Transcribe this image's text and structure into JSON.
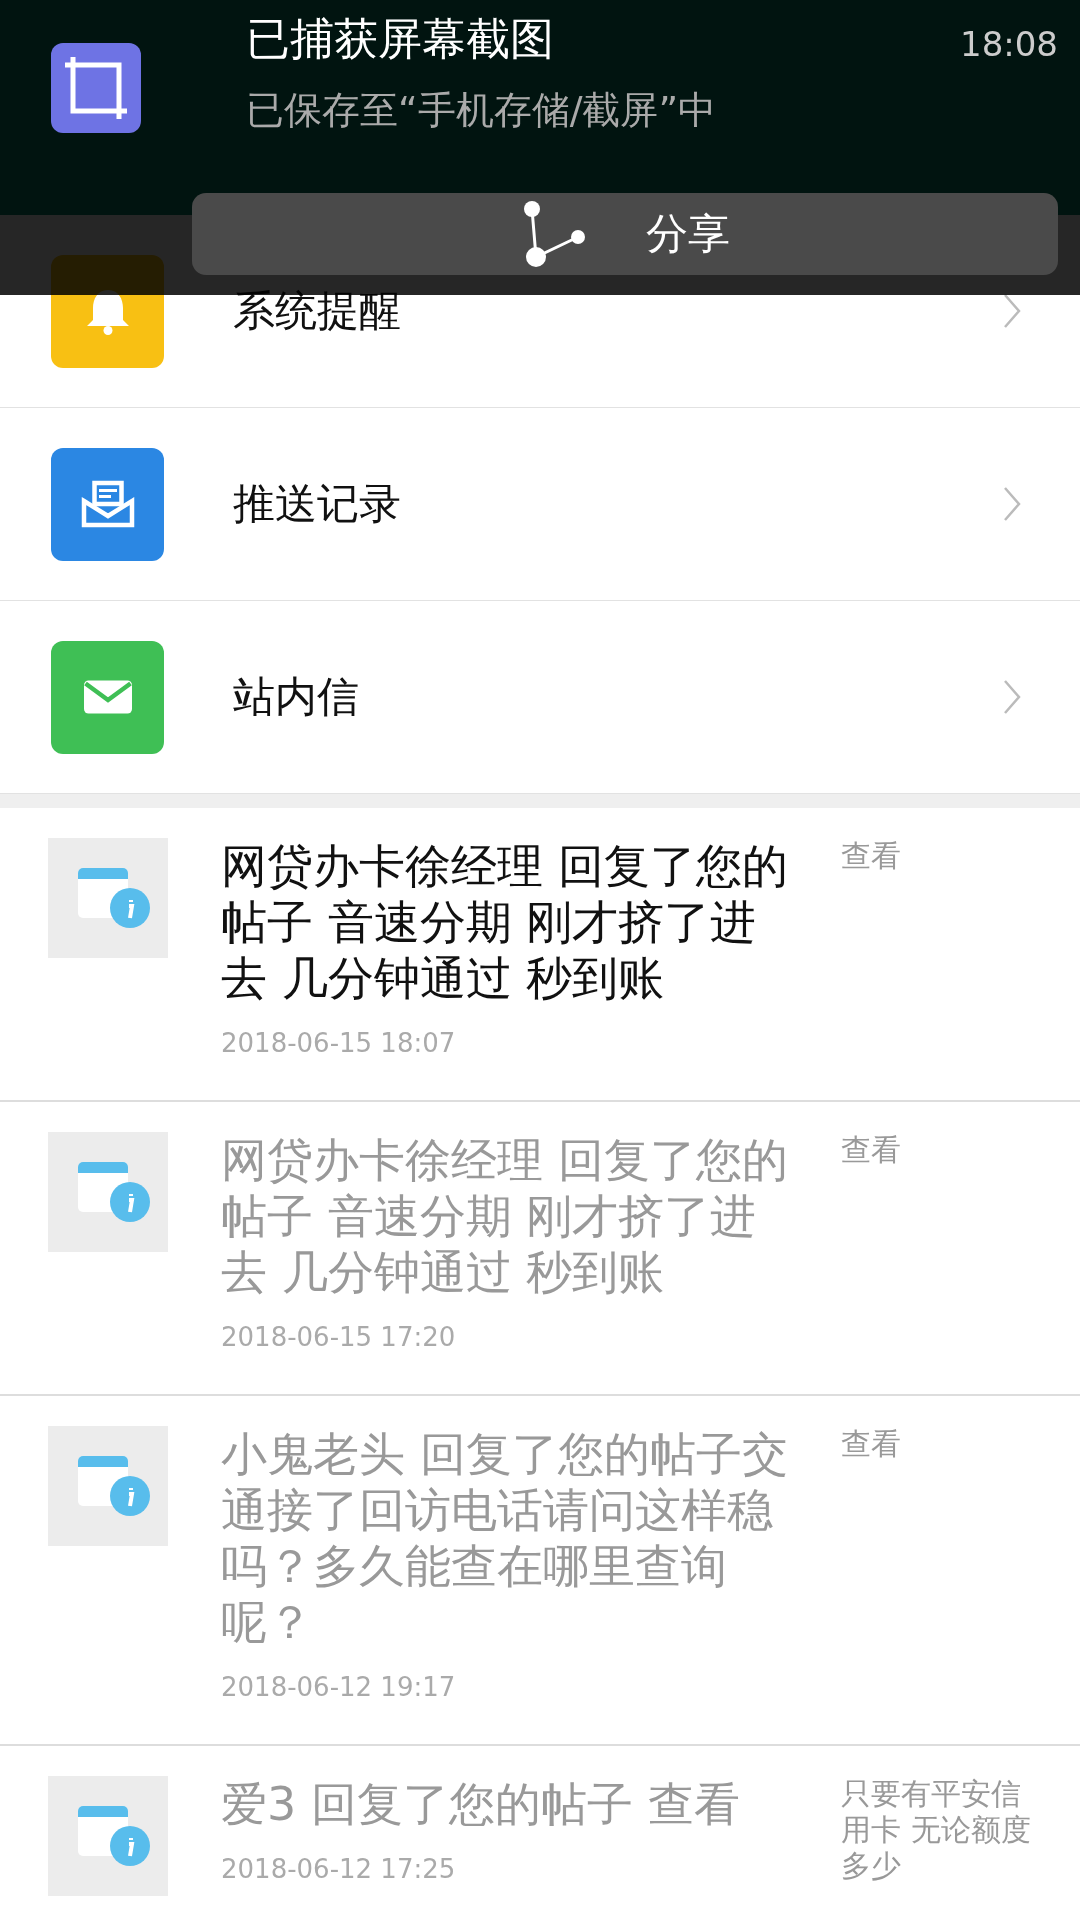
{
  "screenshot_notice": {
    "title": "已捕获屏幕截图",
    "subtitle": "已保存至“手机存储/截屏”中",
    "time": "18:08",
    "share": "分享"
  },
  "categories": [
    {
      "kind": "bell",
      "label": "系统提醒",
      "color": "#f8c013"
    },
    {
      "kind": "inbox",
      "label": "推送记录",
      "color": "#2b87e3"
    },
    {
      "kind": "mail",
      "label": "站内信",
      "color": "#3fbf55"
    }
  ],
  "messages": [
    {
      "title": "网贷办卡徐经理 回复了您的帖子 音速分期 刚才挤了进去 几分钟通过 秒到账",
      "date": "2018-06-15 18:07",
      "side": "查看",
      "read": false
    },
    {
      "title": "网贷办卡徐经理 回复了您的帖子 音速分期 刚才挤了进去 几分钟通过 秒到账",
      "date": "2018-06-15 17:20",
      "side": "查看",
      "read": true
    },
    {
      "title": "小鬼老头 回复了您的帖子交通接了回访电话请问这样稳吗？多久能查在哪里查询呢？",
      "date": "2018-06-12 19:17",
      "side": "查看",
      "read": true
    },
    {
      "title": "爱3 回复了您的帖子  查看",
      "date": "2018-06-12 17:25",
      "side": "只要有平安信用卡 无论额度多少",
      "read": true
    }
  ]
}
